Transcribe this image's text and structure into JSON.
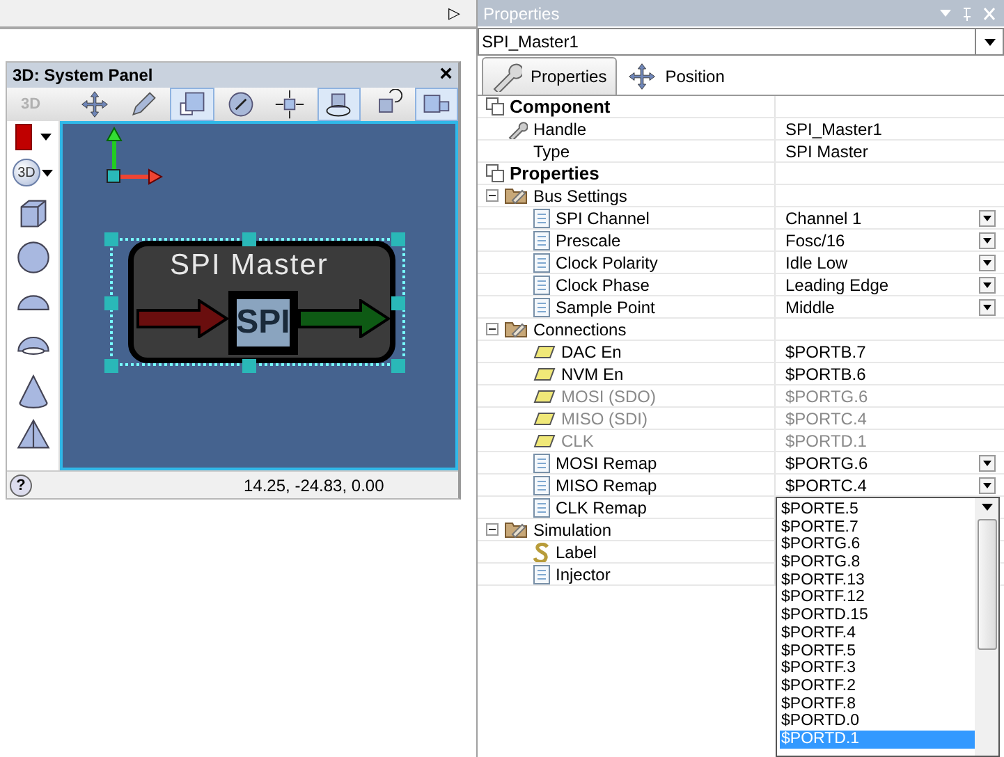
{
  "top_bar": {
    "arrow": "▷"
  },
  "system_panel": {
    "title": "3D: System Panel",
    "close": "×",
    "toolbar_label": "3D",
    "toolbar_buttons": [
      {
        "selected": false
      },
      {
        "selected": false
      },
      {
        "selected": true
      },
      {
        "selected": false
      },
      {
        "selected": false
      },
      {
        "selected": true
      },
      {
        "selected": false
      },
      {
        "selected": true
      }
    ],
    "shape_button": "3D",
    "component": {
      "title": "SPI Master",
      "logo": "SPI"
    },
    "help": "?",
    "coordinates": "14.25, -24.83, 0.00"
  },
  "properties_panel": {
    "title": "Properties",
    "object": "SPI_Master1",
    "tabs": [
      {
        "label": "Properties",
        "selected": true
      },
      {
        "label": "Position",
        "selected": false
      }
    ],
    "grid": [
      {
        "kind": "category",
        "label": "Component",
        "children": [
          {
            "kind": "wrench",
            "label": "Handle",
            "value": "SPI_Master1",
            "dropdown": false,
            "disabled": false
          },
          {
            "kind": "plain",
            "label": "Type",
            "value": "SPI Master",
            "dropdown": false,
            "disabled": false
          }
        ]
      },
      {
        "kind": "category",
        "label": "Properties",
        "children": [
          {
            "kind": "group",
            "label": "Bus Settings",
            "expanded": true,
            "children": [
              {
                "kind": "setting",
                "label": "SPI Channel",
                "value": "Channel 1",
                "dropdown": true,
                "disabled": false
              },
              {
                "kind": "setting",
                "label": "Prescale",
                "value": "Fosc/16",
                "dropdown": true,
                "disabled": false
              },
              {
                "kind": "setting",
                "label": "Clock Polarity",
                "value": "Idle Low",
                "dropdown": true,
                "disabled": false
              },
              {
                "kind": "setting",
                "label": "Clock Phase",
                "value": "Leading Edge",
                "dropdown": true,
                "disabled": false
              },
              {
                "kind": "setting",
                "label": "Sample Point",
                "value": "Middle",
                "dropdown": true,
                "disabled": false
              }
            ]
          },
          {
            "kind": "group",
            "label": "Connections",
            "expanded": true,
            "children": [
              {
                "kind": "pin",
                "label": "DAC En",
                "value": "$PORTB.7",
                "dropdown": false,
                "disabled": false
              },
              {
                "kind": "pin",
                "label": "NVM En",
                "value": "$PORTB.6",
                "dropdown": false,
                "disabled": false
              },
              {
                "kind": "pin",
                "label": "MOSI (SDO)",
                "value": "$PORTG.6",
                "dropdown": false,
                "disabled": true
              },
              {
                "kind": "pin",
                "label": "MISO (SDI)",
                "value": "$PORTC.4",
                "dropdown": false,
                "disabled": true
              },
              {
                "kind": "pin",
                "label": "CLK",
                "value": "$PORTD.1",
                "dropdown": false,
                "disabled": true
              },
              {
                "kind": "setting",
                "label": "MOSI Remap",
                "value": "$PORTG.6",
                "dropdown": true,
                "disabled": false
              },
              {
                "kind": "setting",
                "label": "MISO Remap",
                "value": "$PORTC.4",
                "dropdown": true,
                "disabled": false
              },
              {
                "kind": "setting",
                "label": "CLK Remap",
                "dropdown": false,
                "disabled": false
              }
            ]
          },
          {
            "kind": "group",
            "label": "Simulation",
            "expanded": true,
            "children": [
              {
                "kind": "label",
                "label": "Label",
                "dropdown": false,
                "disabled": false
              },
              {
                "kind": "setting",
                "label": "Injector",
                "dropdown": false,
                "disabled": false
              }
            ]
          }
        ]
      }
    ],
    "dropdown_list": [
      {
        "label": "$PORTE.5",
        "selected": false
      },
      {
        "label": "$PORTE.7",
        "selected": false
      },
      {
        "label": "$PORTG.6",
        "selected": false
      },
      {
        "label": "$PORTG.8",
        "selected": false
      },
      {
        "label": "$PORTF.13",
        "selected": false
      },
      {
        "label": "$PORTF.12",
        "selected": false
      },
      {
        "label": "$PORTD.15",
        "selected": false
      },
      {
        "label": "$PORTF.4",
        "selected": false
      },
      {
        "label": "$PORTF.5",
        "selected": false
      },
      {
        "label": "$PORTF.3",
        "selected": false
      },
      {
        "label": "$PORTF.2",
        "selected": false
      },
      {
        "label": "$PORTF.8",
        "selected": false
      },
      {
        "label": "$PORTD.0",
        "selected": false
      },
      {
        "label": "$PORTD.1",
        "selected": true
      }
    ]
  }
}
